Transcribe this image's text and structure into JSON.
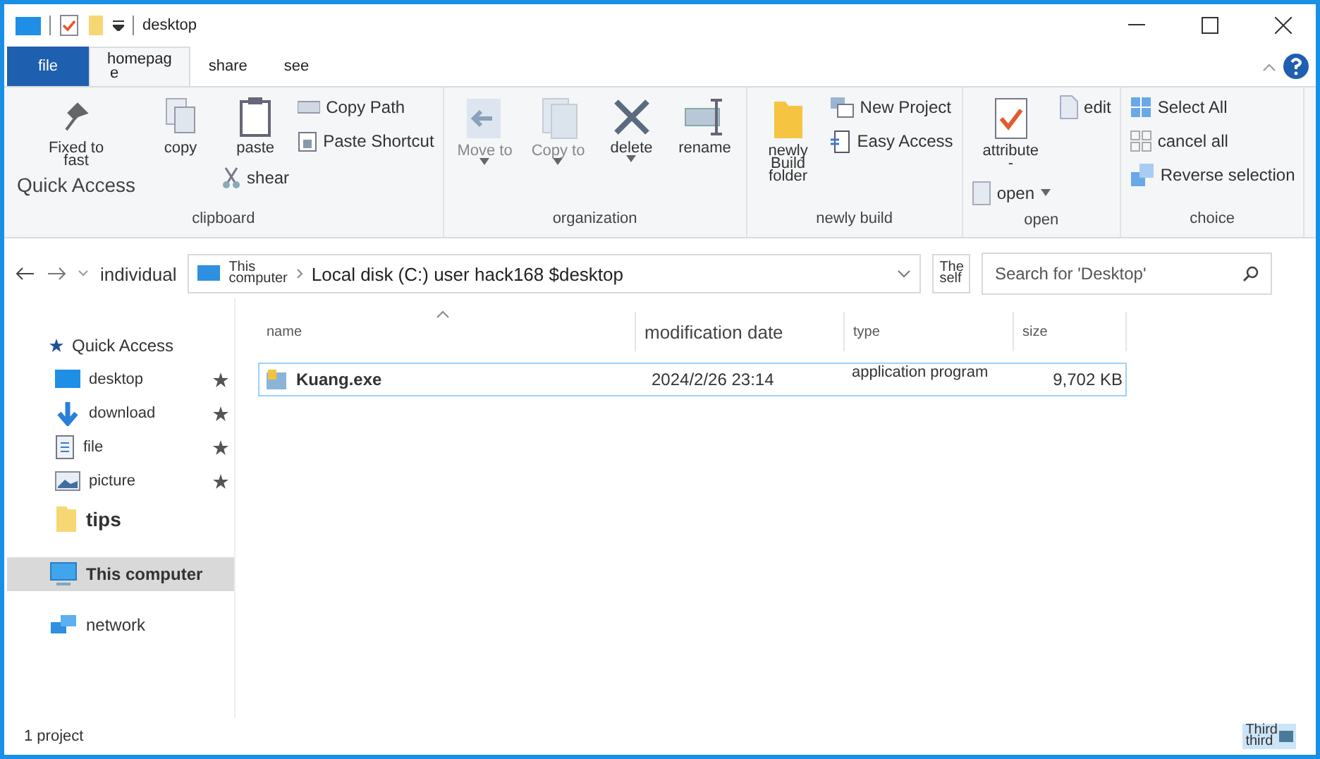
{
  "window": {
    "title": "desktop"
  },
  "tabs": [
    {
      "label": "file",
      "kind": "file",
      "selected": false
    },
    {
      "label": "homepag",
      "label_2": "e",
      "kind": "tab",
      "selected": true
    },
    {
      "label": "share",
      "kind": "tab",
      "selected": false
    },
    {
      "label": "see",
      "kind": "tab",
      "selected": false
    }
  ],
  "ribbon": [
    {
      "label": "clipboard",
      "columns": [
        [
          {
            "kind": "large",
            "lines": [
              "Fixed to",
              "fast"
            ],
            "caption": "Quick Access"
          }
        ],
        [
          {
            "kind": "large",
            "lines": [
              "copy"
            ]
          }
        ],
        [
          {
            "kind": "large",
            "lines": [
              "paste"
            ]
          },
          {
            "kind": "small",
            "lines": [
              "shear"
            ]
          }
        ],
        [
          {
            "kind": "small",
            "lines": [
              "Copy Path"
            ]
          },
          {
            "kind": "small",
            "lines": [
              "Paste Shortcut"
            ]
          }
        ]
      ]
    },
    {
      "label": "organization",
      "columns": [
        [
          {
            "kind": "large",
            "lines": [
              "Move to"
            ],
            "disabled": true,
            "dropdown": true
          }
        ],
        [
          {
            "kind": "large",
            "lines": [
              "Copy to"
            ],
            "disabled": true,
            "dropdown": true
          }
        ],
        [
          {
            "kind": "large",
            "lines": [
              "delete"
            ],
            "dropdown": true
          }
        ],
        [
          {
            "kind": "large",
            "lines": [
              "rename"
            ]
          }
        ]
      ]
    },
    {
      "label": "newly build",
      "columns": [
        [
          {
            "kind": "large",
            "lines": [
              "newly",
              "Build",
              "folder"
            ]
          }
        ],
        [
          {
            "kind": "small",
            "lines": [
              "New Project"
            ]
          },
          {
            "kind": "small",
            "lines": [
              "Easy Access"
            ]
          }
        ]
      ]
    },
    {
      "label": "open",
      "columns": [
        [
          {
            "kind": "large",
            "lines": [
              "attribute",
              "-"
            ]
          },
          {
            "kind": "small",
            "lines": [
              "open"
            ],
            "dropdown": true
          }
        ],
        [
          {
            "kind": "small",
            "lines": [
              "edit"
            ]
          }
        ]
      ]
    },
    {
      "label": "choice",
      "columns": [
        [
          {
            "kind": "small",
            "lines": [
              "Select All"
            ]
          },
          {
            "kind": "small",
            "lines": [
              "cancel all"
            ]
          },
          {
            "kind": "small",
            "lines": [
              "Reverse selection"
            ]
          }
        ]
      ]
    }
  ],
  "address_bar": {
    "location": "individual",
    "crumb": [
      "This",
      "computer"
    ],
    "path": "Local disk (C:) user hack168 $desktop",
    "side_button": [
      "The",
      "self"
    ]
  },
  "search": {
    "placeholder": "Search for 'Desktop'"
  },
  "sidebar": [
    {
      "label": "Quick Access",
      "selected": false,
      "children": [
        {
          "label": "desktop",
          "pinned": true,
          "selected": false
        },
        {
          "label": "download",
          "pinned": true,
          "selected": false
        },
        {
          "label": "file",
          "pinned": true,
          "selected": false
        },
        {
          "label": "picture",
          "pinned": true,
          "selected": false
        },
        {
          "label": "tips",
          "pinned": false,
          "selected": false
        }
      ]
    },
    {
      "label": "This computer",
      "selected": true
    },
    {
      "label": "network",
      "selected": false
    }
  ],
  "table": {
    "columns": [
      "name",
      "modification date",
      "type",
      "size"
    ],
    "rows": [
      {
        "name": "Kuang.exe",
        "modified": "2024/2/26 23:14",
        "type": "application program",
        "size": "9,702 KB",
        "selected": true
      }
    ]
  },
  "status_bar": {
    "count": "1 project",
    "view_button": [
      "Third",
      "third"
    ]
  }
}
